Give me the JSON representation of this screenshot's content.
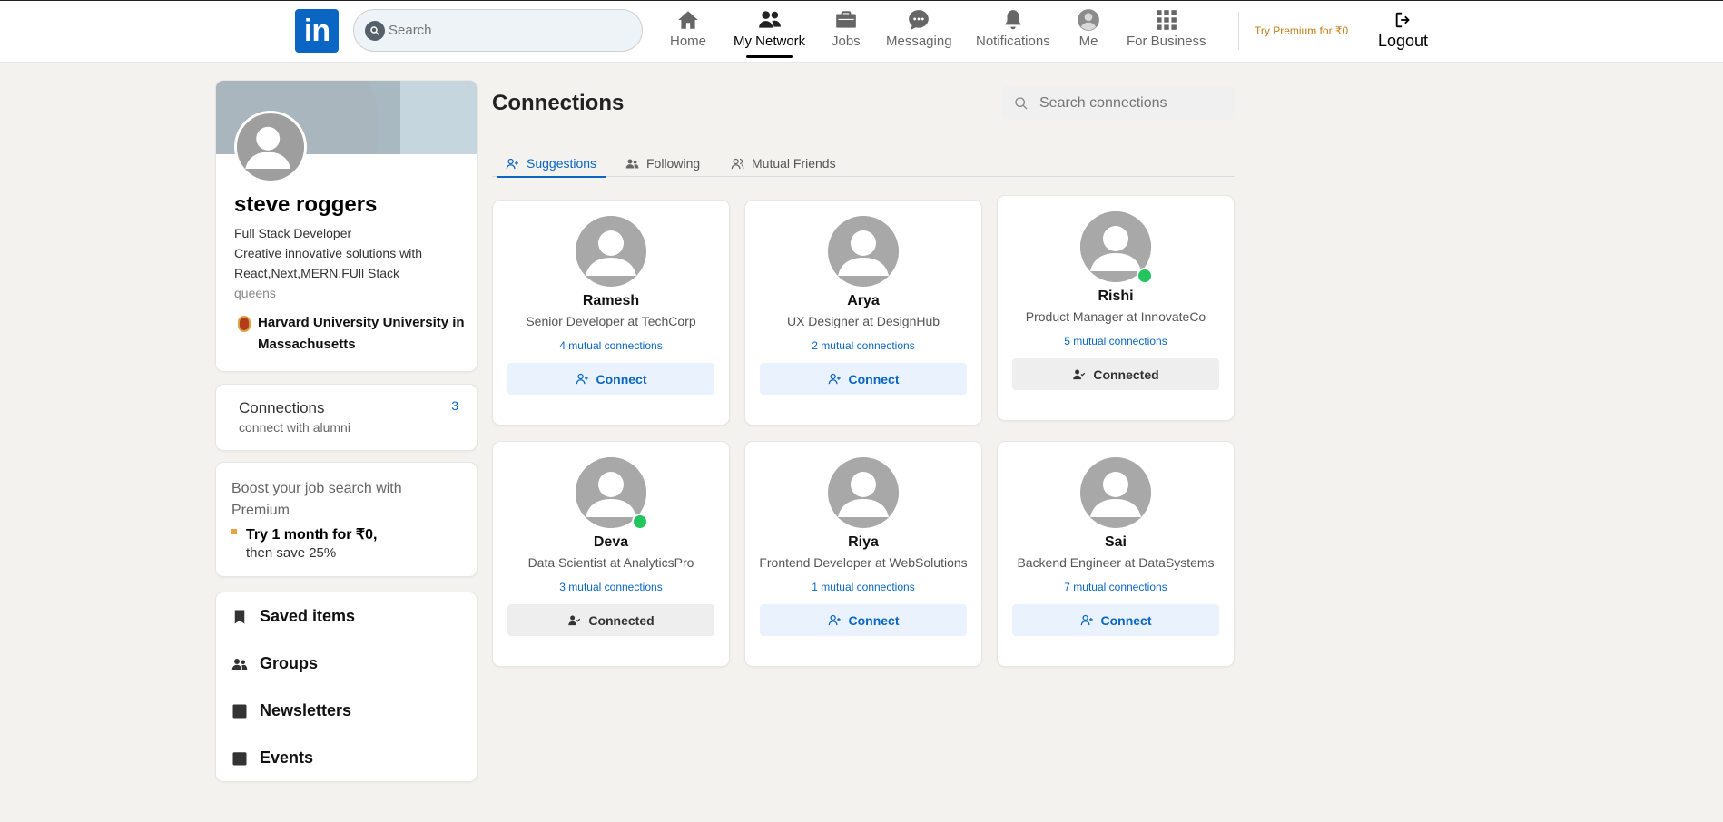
{
  "topbar": {
    "logo": "in",
    "search_placeholder": "Search",
    "nav": [
      {
        "label": "Home",
        "icon": "home-icon"
      },
      {
        "label": "My Network",
        "icon": "network-icon",
        "active": true
      },
      {
        "label": "Jobs",
        "icon": "briefcase-icon"
      },
      {
        "label": "Messaging",
        "icon": "messaging-icon"
      },
      {
        "label": "Notifications",
        "icon": "bell-icon"
      },
      {
        "label": "Me",
        "icon": "avatar-icon"
      },
      {
        "label": "For Business",
        "icon": "grid-icon"
      }
    ],
    "premium_link": "Try Premium for ₹0",
    "logout": "Logout"
  },
  "profile": {
    "name": "steve roggers",
    "headline": "Full Stack Developer",
    "about_line1": "Creative innovative solutions with",
    "about_line2": "React,Next,MERN,FUll Stack",
    "location": "queens",
    "school": "Harvard University University in Massachusetts"
  },
  "connections_box": {
    "title": "Connections",
    "subtitle": "connect with alumni",
    "count": "3"
  },
  "promo": {
    "text": "Boost your job search with Premium",
    "offer_line1": "Try 1 month for ₹0,",
    "offer_line2": "then save 25%"
  },
  "links": [
    {
      "label": "Saved items",
      "icon": "bookmark-icon"
    },
    {
      "label": "Groups",
      "icon": "groups-icon"
    },
    {
      "label": "Newsletters",
      "icon": "newsletter-icon"
    },
    {
      "label": "Events",
      "icon": "calendar-icon"
    }
  ],
  "main": {
    "title": "Connections",
    "search_placeholder": "Search connections",
    "tabs": [
      {
        "label": "Suggestions",
        "active": true
      },
      {
        "label": "Following"
      },
      {
        "label": "Mutual Friends"
      }
    ],
    "people": [
      {
        "name": "Ramesh",
        "role": "Senior Developer at TechCorp",
        "mutual": "4 mutual connections",
        "button": "Connect",
        "connected": false,
        "online": false
      },
      {
        "name": "Arya",
        "role": "UX Designer at DesignHub",
        "mutual": "2 mutual connections",
        "button": "Connect",
        "connected": false,
        "online": false
      },
      {
        "name": "Rishi",
        "role": "Product Manager at InnovateCo",
        "mutual": "5 mutual connections",
        "button": "Connected",
        "connected": true,
        "online": true
      },
      {
        "name": "Deva",
        "role": "Data Scientist at AnalyticsPro",
        "mutual": "3 mutual connections",
        "button": "Connected",
        "connected": true,
        "online": true
      },
      {
        "name": "Riya",
        "role": "Frontend Developer at WebSolutions",
        "mutual": "1 mutual connections",
        "button": "Connect",
        "connected": false,
        "online": false
      },
      {
        "name": "Sai",
        "role": "Backend Engineer at DataSystems",
        "mutual": "7 mutual connections",
        "button": "Connect",
        "connected": false,
        "online": false
      }
    ]
  },
  "colors": {
    "accent": "#0a66c2",
    "background": "#f3f2ef",
    "online": "#22c55e",
    "premium": "#c37d16"
  }
}
